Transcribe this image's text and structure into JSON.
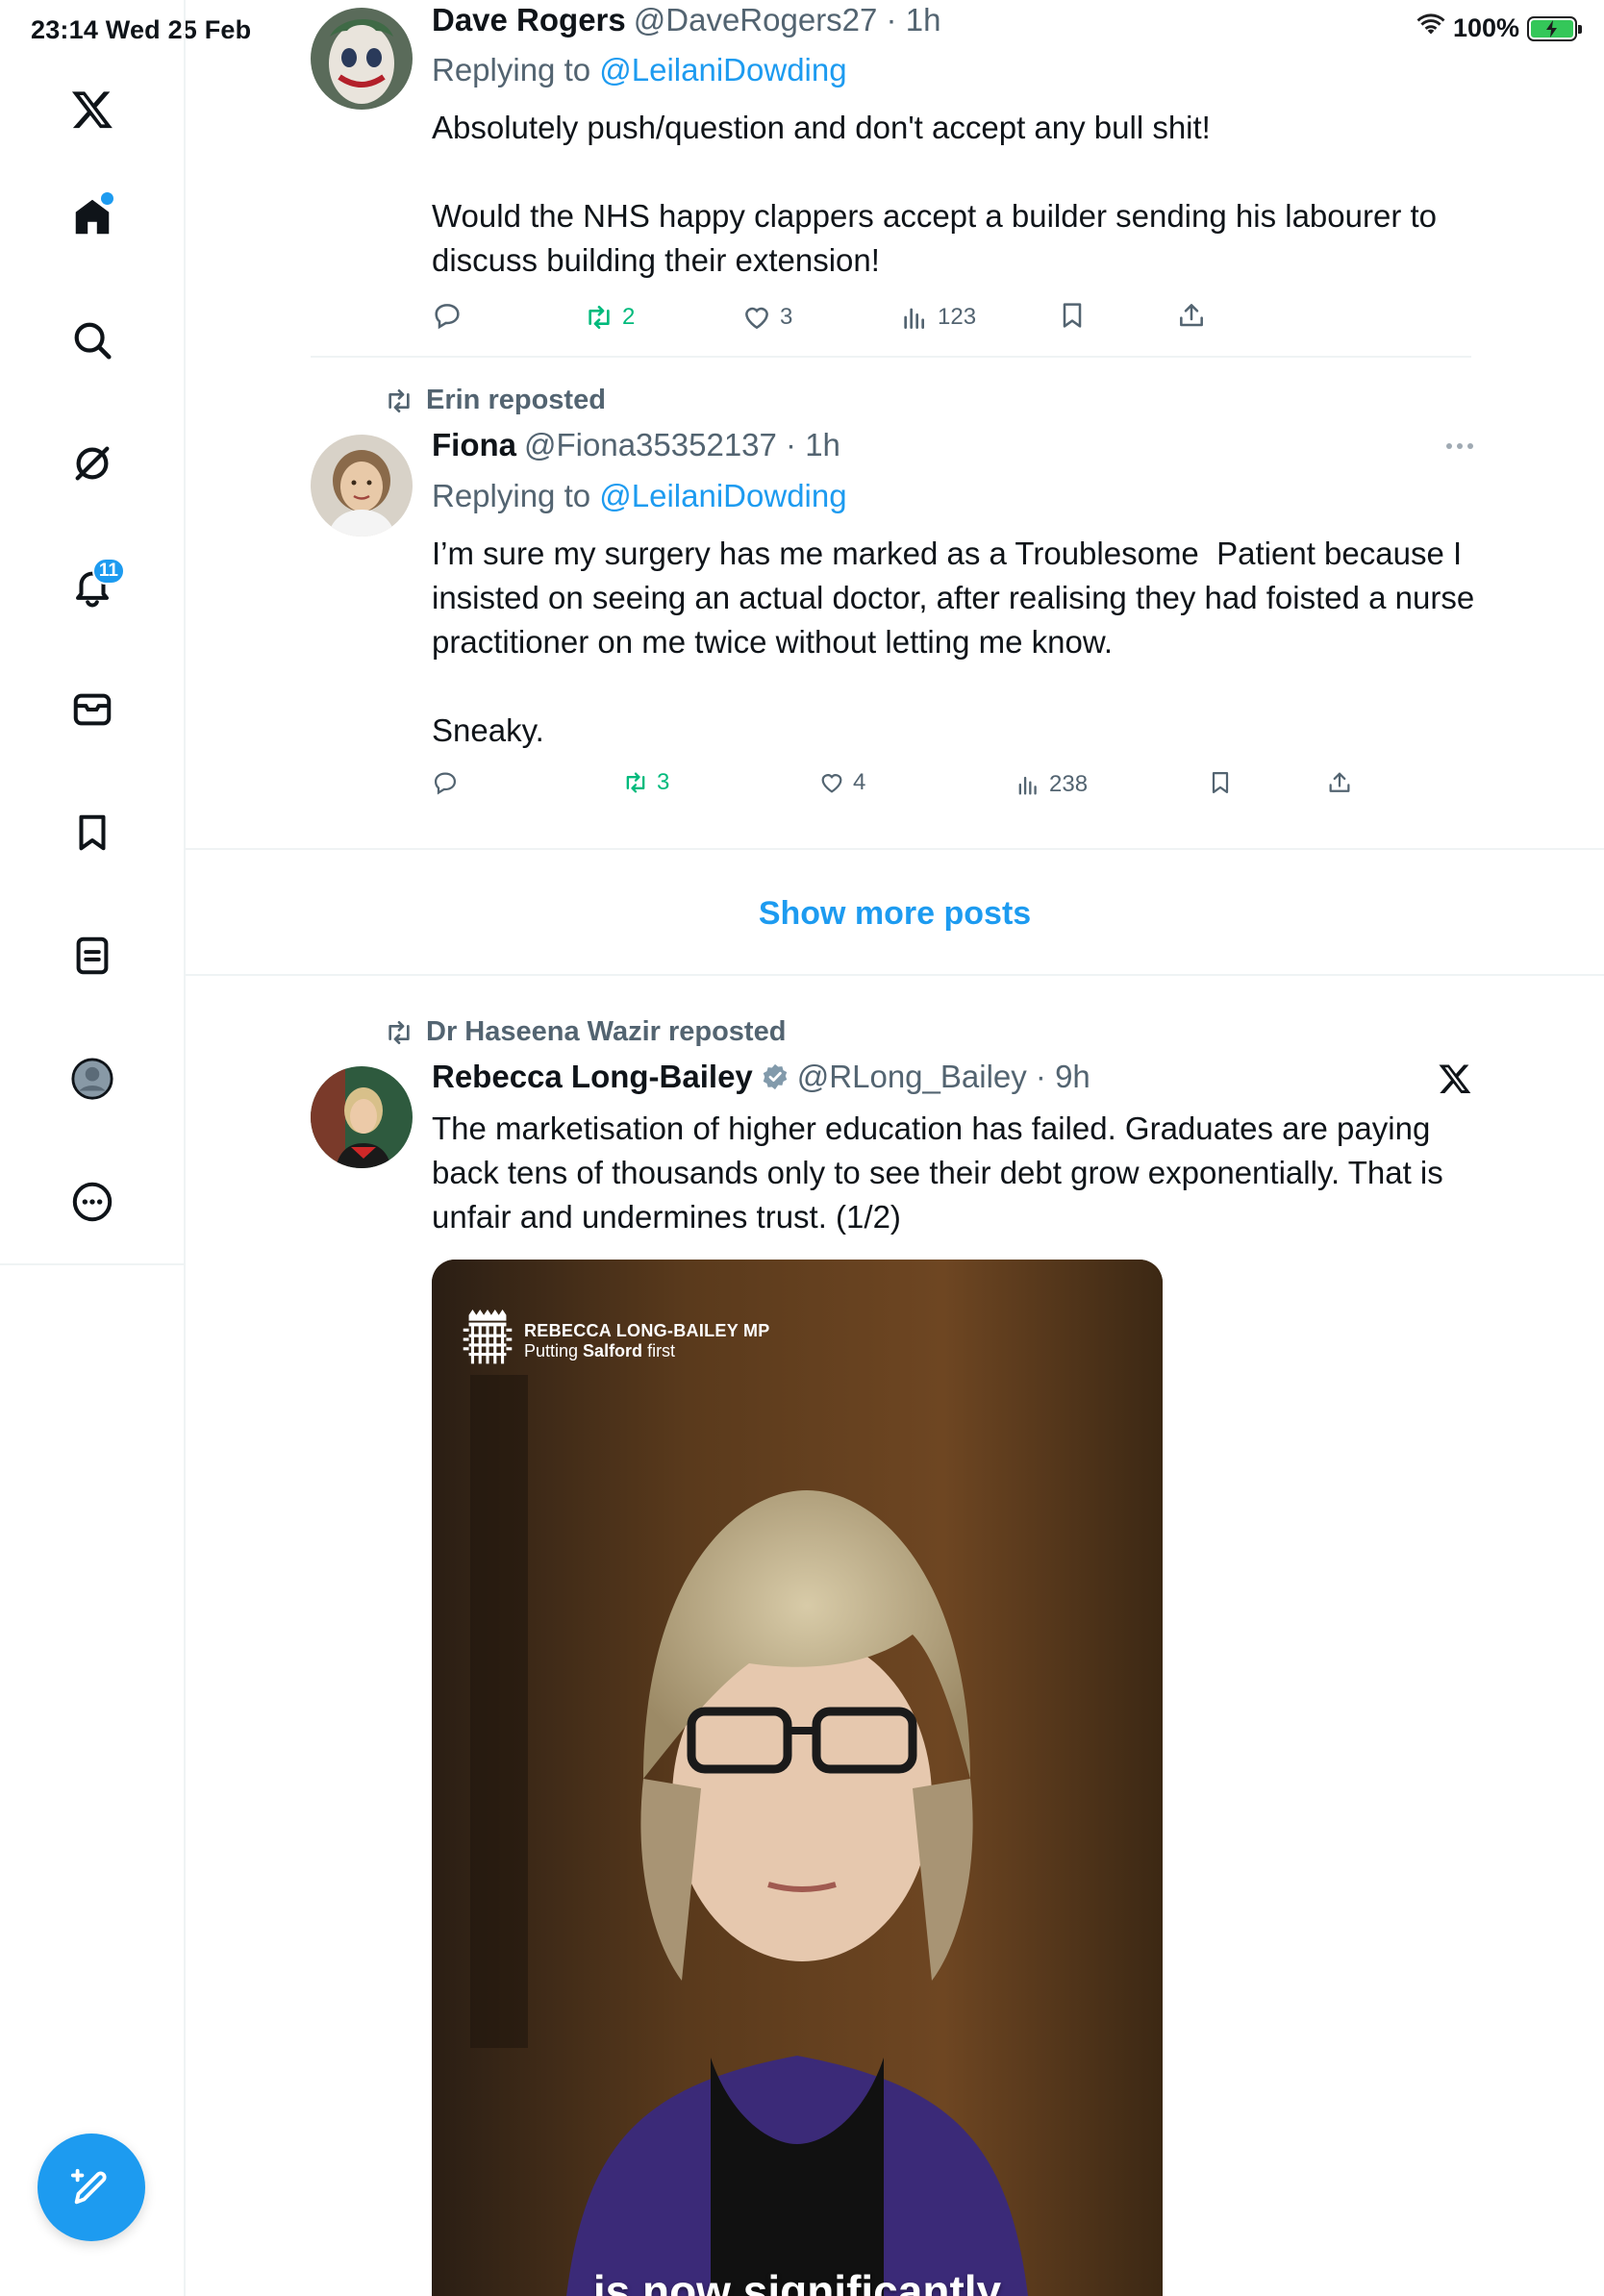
{
  "status_bar": {
    "time_date": "23:14   Wed 25 Feb",
    "battery": "100%"
  },
  "sidebar": {
    "notifications_badge": "11"
  },
  "tweets": [
    {
      "name": "Dave Rogers",
      "handle": "@DaveRogers27 · 1h",
      "replying_prefix": "Replying to ",
      "replying_to": "@LeilaniDowding",
      "text": "Absolutely push/question and don't accept any bull shit!\n\nWould the NHS happy clappers accept a builder sending his labourer to discuss building their extension!",
      "reposts": "2",
      "likes": "3",
      "views": "123"
    },
    {
      "reposted_by": "Erin reposted",
      "name": "Fiona",
      "handle": "@Fiona35352137 · 1h",
      "replying_prefix": "Replying to ",
      "replying_to": "@LeilaniDowding",
      "text": "I’m sure my surgery has me marked as a Troublesome  Patient because I insisted on seeing an actual doctor, after realising they had foisted a nurse practitioner on me twice without letting me know.\n\nSneaky.",
      "reposts": "3",
      "likes": "4",
      "views": "238"
    },
    {
      "reposted_by": "Dr Haseena Wazir reposted",
      "name": "Rebecca Long-Bailey",
      "handle": "@RLong_Bailey · 9h",
      "text": "The marketisation of higher education has failed. Graduates are paying back tens of thousands only to see their debt grow exponentially. That is unfair and undermines trust. (1/2)",
      "video_brand_title": "REBECCA LONG-BAILEY MP",
      "video_brand_sub_prefix": "Putting ",
      "video_brand_sub_bold": "Salford",
      "video_brand_sub_suffix": " first",
      "video_caption": "is now significantly"
    }
  ],
  "show_more": "Show more posts",
  "colors": {
    "accent": "#1d9bf0",
    "repost_green": "#00ba7c",
    "secondary_text": "#536471",
    "divider": "#eff3f4"
  }
}
